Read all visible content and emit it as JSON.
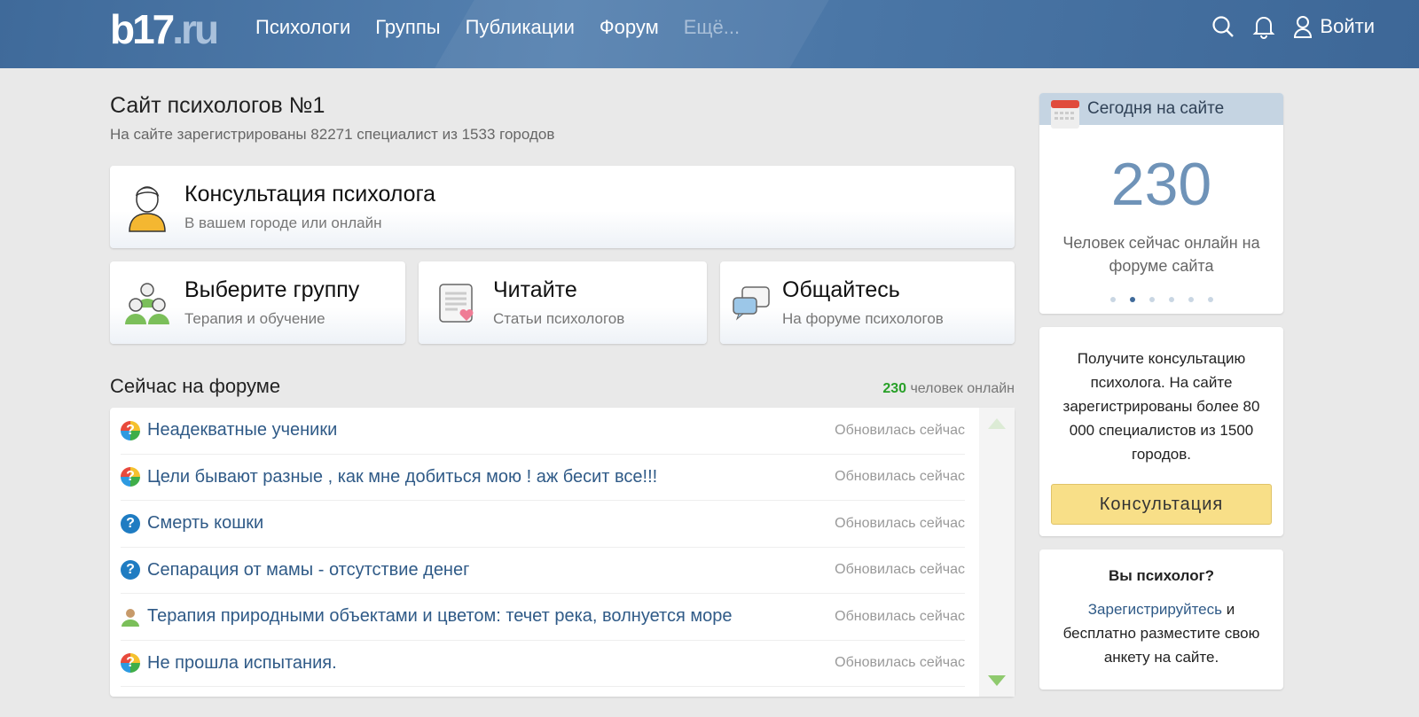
{
  "header": {
    "logo": "b17",
    "logo_suffix": ".ru",
    "nav": [
      "Психологи",
      "Группы",
      "Публикации",
      "Форум"
    ],
    "more": "Ещё...",
    "login": "Войти"
  },
  "main": {
    "title": "Сайт психологов №1",
    "subtitle": "На сайте зарегистрированы 82271 специалист из 1533 городов",
    "consult": {
      "title": "Консультация психолога",
      "sub": "В вашем городе или онлайн"
    },
    "cards": [
      {
        "title": "Выберите группу",
        "sub": "Терапия и обучение"
      },
      {
        "title": "Читайте",
        "sub": "Статьи психологов"
      },
      {
        "title": "Общайтесь",
        "sub": "На форуме психологов"
      }
    ],
    "forum": {
      "heading": "Сейчас на форуме",
      "count": "230",
      "count_label": "человек онлайн",
      "topics": [
        {
          "title": "Неадекватные ученики",
          "status": "Обновилась сейчас",
          "icon": "multicolor-question"
        },
        {
          "title": "Цели бывают разные , как мне добиться мою ! аж бесит все!!!",
          "status": "Обновилась сейчас",
          "icon": "multicolor-question"
        },
        {
          "title": "Смерть кошки",
          "status": "Обновилась сейчас",
          "icon": "blue-question"
        },
        {
          "title": "Сепарация от мамы - отсутствие денег",
          "status": "Обновилась сейчас",
          "icon": "blue-question"
        },
        {
          "title": "Терапия природными объектами и цветом: течет река, волнуется море",
          "status": "Обновилась сейчас",
          "icon": "user"
        },
        {
          "title": "Не прошла испытания.",
          "status": "Обновилась сейчас",
          "icon": "multicolor-question"
        }
      ]
    }
  },
  "sidebar": {
    "today": {
      "title": "Сегодня на сайте",
      "number": "230",
      "caption": "Человек сейчас онлайн на форуме сайта",
      "active_slide": 2,
      "slides": 6
    },
    "promo": {
      "text": "Получите консультацию психолога. На сайте зарегистрированы более 80 000 специалистов из 1500 городов.",
      "button": "Консультация"
    },
    "psych": {
      "title": "Вы психолог?",
      "link": "Зарегистрируйтесь",
      "text": " и бесплатно разместите свою анкету на сайте."
    }
  }
}
